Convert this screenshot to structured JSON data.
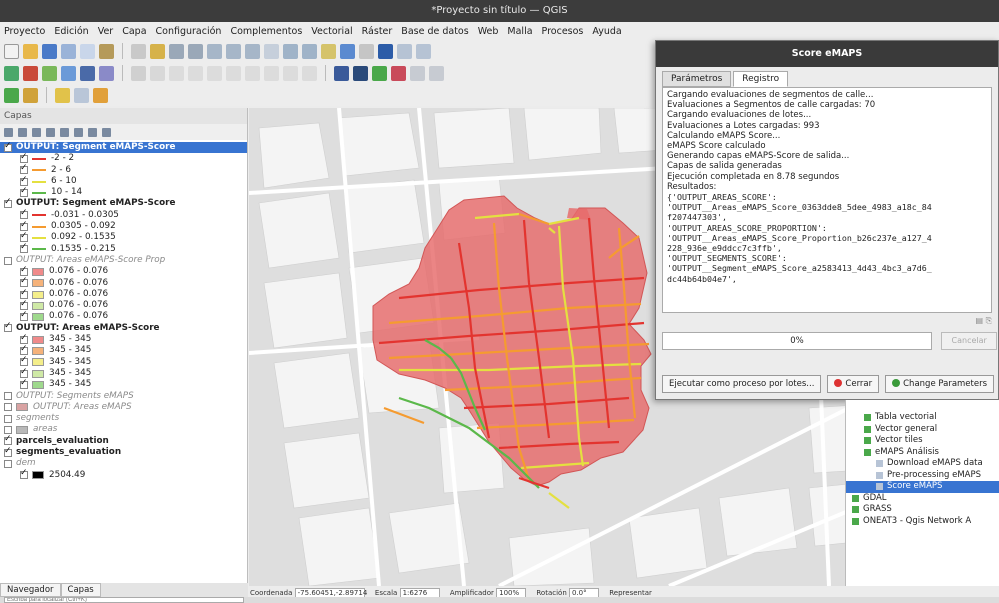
{
  "window": {
    "title": "*Proyecto sin título — QGIS"
  },
  "menu": [
    "Proyecto",
    "Edición",
    "Ver",
    "Capa",
    "Configuración",
    "Complementos",
    "Vectorial",
    "Ráster",
    "Base de datos",
    "Web",
    "Malla",
    "Procesos",
    "Ayuda"
  ],
  "layers_panel": {
    "title": "Capas",
    "items": [
      {
        "label": "OUTPUT: Segment eMAPS-Score",
        "kind": "group",
        "selected": true
      },
      {
        "label": "-2 - 2",
        "swatch": "#e3342f",
        "type": "line"
      },
      {
        "label": "2 - 6",
        "swatch": "#f59b30",
        "type": "line"
      },
      {
        "label": "6 - 10",
        "swatch": "#e4e040",
        "type": "line"
      },
      {
        "label": "10 - 14",
        "swatch": "#5bb84a",
        "type": "line"
      },
      {
        "label": "OUTPUT: Segment eMAPS-Score",
        "kind": "group"
      },
      {
        "label": "-0.031 - 0.0305",
        "swatch": "#e3342f",
        "type": "line"
      },
      {
        "label": "0.0305 - 0.092",
        "swatch": "#f59b30",
        "type": "line"
      },
      {
        "label": "0.092 - 0.1535",
        "swatch": "#e4e040",
        "type": "line"
      },
      {
        "label": "0.1535 - 0.215",
        "swatch": "#5bb84a",
        "type": "line"
      },
      {
        "label": "OUTPUT: Areas eMAPS-Score Prop",
        "kind": "dim"
      },
      {
        "label": "0.076 - 0.076",
        "swatch": "#f08a8a",
        "type": "box"
      },
      {
        "label": "0.076 - 0.076",
        "swatch": "#f5b27a",
        "type": "box"
      },
      {
        "label": "0.076 - 0.076",
        "swatch": "#f4ee8a",
        "type": "box"
      },
      {
        "label": "0.076 - 0.076",
        "swatch": "#cfe9a6",
        "type": "box"
      },
      {
        "label": "0.076 - 0.076",
        "swatch": "#9fd98d",
        "type": "box"
      },
      {
        "label": "OUTPUT: Areas eMAPS-Score",
        "kind": "group"
      },
      {
        "label": "345 - 345",
        "swatch": "#f08a8a",
        "type": "box"
      },
      {
        "label": "345 - 345",
        "swatch": "#f5b27a",
        "type": "box"
      },
      {
        "label": "345 - 345",
        "swatch": "#f4ee8a",
        "type": "box"
      },
      {
        "label": "345 - 345",
        "swatch": "#cfe9a6",
        "type": "box"
      },
      {
        "label": "345 - 345",
        "swatch": "#9fd98d",
        "type": "box"
      },
      {
        "label": "OUTPUT: Segments eMAPS",
        "kind": "dim"
      },
      {
        "label": "OUTPUT: Areas eMAPS",
        "kind": "dim",
        "swatch": "#d9a3a3",
        "type": "box"
      },
      {
        "label": "segments",
        "kind": "dim"
      },
      {
        "label": "areas",
        "kind": "dim",
        "swatch": "#b9b9b9",
        "type": "box"
      },
      {
        "label": "parcels_evaluation",
        "kind": "group"
      },
      {
        "label": "segments_evaluation",
        "kind": "group"
      },
      {
        "label": "dem",
        "kind": "dim"
      },
      {
        "label": "2504.49",
        "swatch": "#000000",
        "type": "box"
      }
    ]
  },
  "bottom_tabs": [
    "Navegador",
    "Capas"
  ],
  "locator": {
    "placeholder": "Escriba para localizar (Ctrl+K)"
  },
  "statusbar": {
    "coordinate_label": "Coordenada",
    "coordinate": "-75.60451,-2.89714",
    "scale_label": "Escala",
    "scale": "1:6276",
    "magnifier_label": "Amplificador",
    "magnifier": "100%",
    "rotation_label": "Rotación",
    "rotation": "0.0°",
    "render_label": "Representar"
  },
  "dialog": {
    "title": "Score eMAPS",
    "tabs": [
      "Parámetros",
      "Registro"
    ],
    "active_tab": "Registro",
    "log_lines": [
      "Cargando evaluaciones de segmentos de calle...",
      "Evaluaciones a Segmentos de calle cargadas: 70",
      "Cargando evaluaciones de lotes...",
      "Evaluaciones a Lotes cargadas: 993",
      "Calculando eMAPS Score...",
      "eMAPS Score calculado",
      "Generando capas eMAPS-Score de salida...",
      "Capas de salida generadas",
      "Ejecución completada en 8.78 segundos",
      "Resultados:"
    ],
    "log_mono": [
      "{'OUTPUT_AREAS_SCORE':",
      "'OUTPUT__Areas_eMAPS_Score_0363dde8_5dee_4983_a18c_84",
      "f207447303',",
      "'OUTPUT_AREAS_SCORE_PROPORTION':",
      "'OUTPUT__Areas_eMAPS_Score_Proportion_b26c237e_a127_4",
      "228_936e_e9ddcc7c3ffb',",
      "'OUTPUT_SEGMENTS_SCORE':",
      "'OUTPUT__Segment_eMAPS_Score_a2583413_4d43_4bc3_a7d6_",
      "dc44b64b04e7',"
    ],
    "progress": "0%",
    "cancel_label": "Cancelar",
    "buttons": {
      "batch": "Ejecutar como proceso por lotes...",
      "close": "Cerrar",
      "change": "Change Parameters"
    }
  },
  "processing": {
    "items": [
      {
        "label": "Tabla vectorial",
        "indent": 1
      },
      {
        "label": "Vector general",
        "indent": 1
      },
      {
        "label": "Vector tiles",
        "indent": 1
      },
      {
        "label": "eMAPS Análisis",
        "indent": 1
      },
      {
        "label": "Download eMAPS data",
        "indent": 2
      },
      {
        "label": "Pre-processing eMAPS",
        "indent": 2
      },
      {
        "label": "Score eMAPS",
        "indent": 2,
        "selected": true
      },
      {
        "label": "GDAL",
        "indent": 0
      },
      {
        "label": "GRASS",
        "indent": 0
      },
      {
        "label": "ONEAT3 - Qgis Network A",
        "indent": 0
      }
    ]
  },
  "colors": {
    "red": "#e3342f",
    "orange": "#f59b30",
    "yellow": "#e4e040",
    "green": "#5bb84a",
    "area_fill": "#e76a6a",
    "selection": "#3874d1"
  }
}
